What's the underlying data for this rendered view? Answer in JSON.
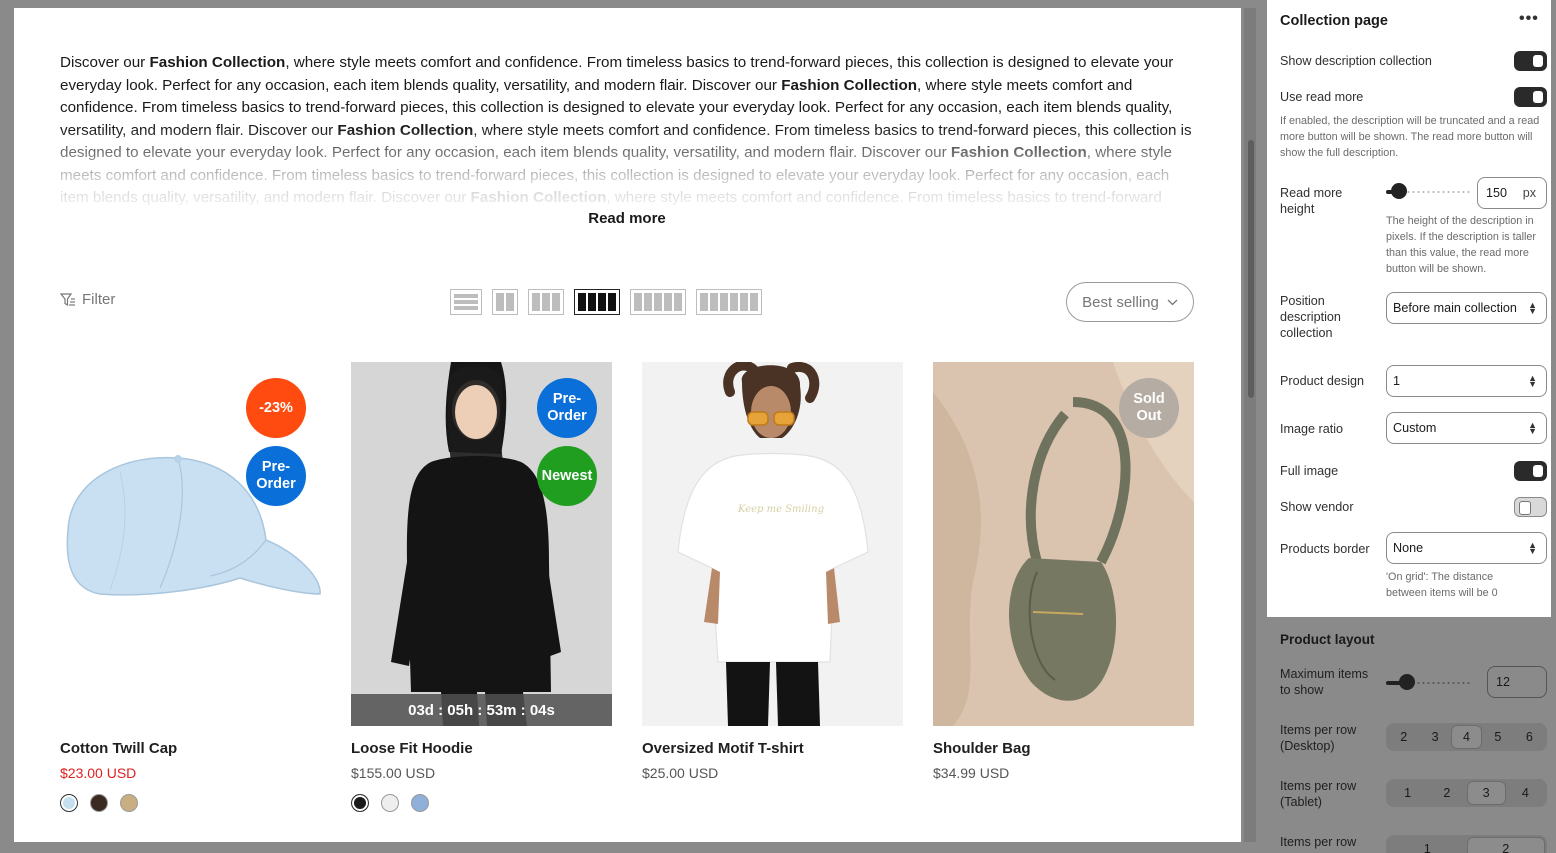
{
  "description": {
    "intro": "Discover our",
    "bold": "Fashion Collection",
    "rest": ", where style meets comfort and confidence. From timeless basics to trend-forward pieces, this collection is designed to elevate your everyday look. Perfect for any occasion, each item blends quality, versatility, and modern flair.",
    "repeat_count": 5,
    "read_more_label": "Read more"
  },
  "toolbar": {
    "filter_label": "Filter",
    "layout_options": [
      "list",
      "2",
      "3",
      "4",
      "5",
      "6"
    ],
    "active_layout": "4",
    "sort_label": "Best selling"
  },
  "products": [
    {
      "name": "Cotton Twill Cap",
      "price": "$23.00 USD",
      "on_sale": true,
      "badges": [
        {
          "text": "-23%",
          "color": "#ff4b0f"
        },
        {
          "text": "Pre-\nOrder",
          "color": "#0a6fd9"
        }
      ],
      "swatch_colors": [
        "#c6dff0",
        "#3a2a22",
        "#c9ae82"
      ],
      "countdown": ""
    },
    {
      "name": "Loose Fit Hoodie",
      "price": "$155.00 USD",
      "on_sale": false,
      "badges": [
        {
          "text": "Pre-\nOrder",
          "color": "#0a6fd9"
        },
        {
          "text": "Newest",
          "color": "#1f9e1f"
        }
      ],
      "swatch_colors": [
        "#1a1a1a",
        "#eeeeee",
        "#8fb0d8"
      ],
      "countdown": "03d : 05h : 53m : 04s"
    },
    {
      "name": "Oversized Motif T-shirt",
      "price": "$25.00 USD",
      "on_sale": false,
      "badges": [],
      "swatch_colors": [],
      "countdown": ""
    },
    {
      "name": "Shoulder Bag",
      "price": "$34.99 USD",
      "on_sale": false,
      "badges": [
        {
          "text": "Sold\nOut",
          "color": "#b5aca4"
        }
      ],
      "swatch_colors": [],
      "countdown": ""
    }
  ],
  "settings": {
    "title": "Collection page",
    "show_description_label": "Show description collection",
    "show_description_on": true,
    "use_read_more_label": "Use read more",
    "use_read_more_on": true,
    "use_read_more_help": "If enabled, the description will be truncated and a read more button will be shown. The read more button will show the full description.",
    "read_more_height_label": "Read more\nheight",
    "read_more_height_value": "150",
    "read_more_height_unit": "px",
    "read_more_height_fraction": 0.15,
    "read_more_height_help": "The height of the description in pixels. If the description is taller than this value, the read more button will be shown.",
    "position_label": "Position\ndescription\ncollection",
    "position_value": "Before main collection",
    "product_design_label": "Product design",
    "product_design_value": "1",
    "image_ratio_label": "Image ratio",
    "image_ratio_value": "Custom",
    "full_image_label": "Full image",
    "full_image_on": true,
    "show_vendor_label": "Show vendor",
    "show_vendor_on": false,
    "products_border_label": "Products border",
    "products_border_value": "None",
    "products_border_help": "'On grid': The distance between items will be 0"
  },
  "product_layout": {
    "title": "Product layout",
    "max_items_label": "Maximum items\nto show",
    "max_items_value": "12",
    "max_items_fraction": 0.25,
    "desktop_label": "Items per row\n(Desktop)",
    "desktop_options": [
      "2",
      "3",
      "4",
      "5",
      "6"
    ],
    "desktop_selected": "4",
    "tablet_label": "Items per row\n(Tablet)",
    "tablet_options": [
      "1",
      "2",
      "3",
      "4"
    ],
    "tablet_selected": "3",
    "mobile_label": "Items per row",
    "mobile_options": [
      "1",
      "2"
    ],
    "mobile_selected": "2"
  }
}
